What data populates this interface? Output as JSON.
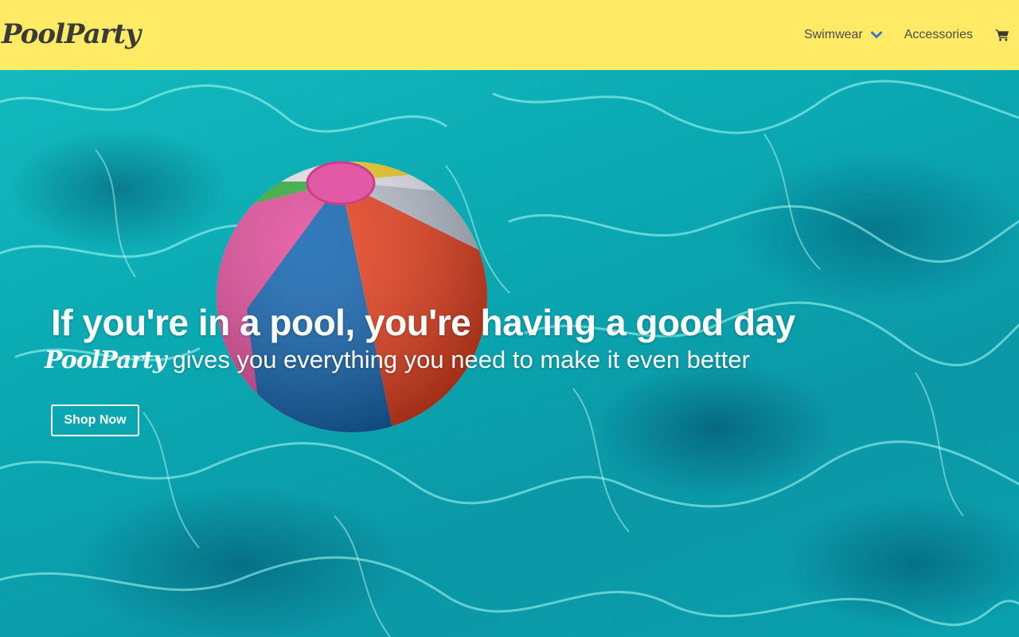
{
  "nav": {
    "logo": "PoolParty",
    "items": [
      {
        "label": "Swimwear",
        "has_dropdown": true,
        "icon": "chevron-down-icon"
      },
      {
        "label": "Accessories",
        "has_dropdown": false
      }
    ],
    "cart_icon": "shopping-cart-icon"
  },
  "hero": {
    "headline": "If you're in a pool, you're having a good day",
    "brand": "PoolParty",
    "subtext": "gives you everything you need to make it even better",
    "cta_label": "Shop Now"
  },
  "colors": {
    "navbar_bg": "#ffeb65",
    "text_dark": "#4a4a4a",
    "accent_blue": "#3d6fd6",
    "water": "#0ab3b8"
  }
}
